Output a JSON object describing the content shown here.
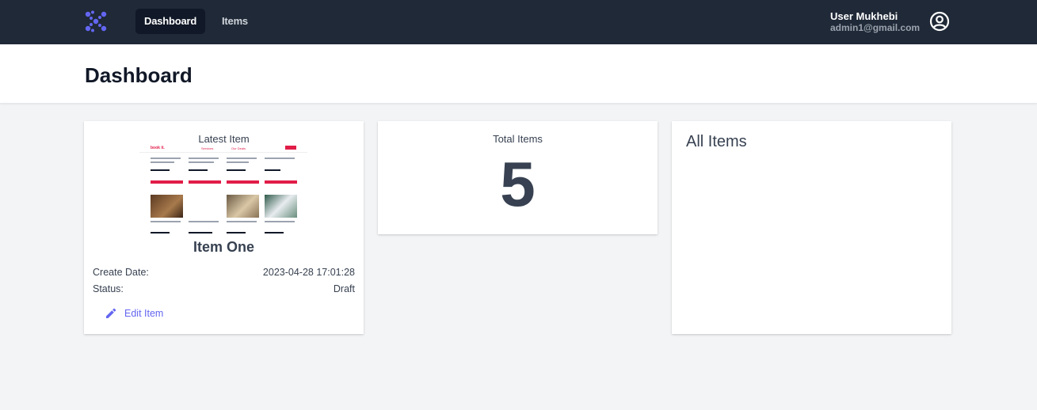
{
  "nav": {
    "links": [
      "Dashboard",
      "Items"
    ],
    "active": "Dashboard",
    "logo_icon": "logo-icon",
    "user_name": "User Mukhebi",
    "user_email": "admin1@gmail.com",
    "user_icon": "user-circle-icon"
  },
  "header": {
    "title": "Dashboard"
  },
  "latest_item": {
    "heading": "Latest Item",
    "name": "Item One",
    "create_date_label": "Create Date:",
    "create_date_value": "2023-04-28 17:01:28",
    "status_label": "Status:",
    "status_value": "Draft",
    "edit_label": "Edit Item",
    "edit_icon": "pencil-icon",
    "thumbnail": {
      "brand": "book it.",
      "tabs": [
        "Services",
        "Our Deals"
      ]
    }
  },
  "total_items": {
    "label": "Total Items",
    "value": "5"
  },
  "all_items": {
    "title": "All Items"
  },
  "colors": {
    "nav_bg": "#1f2937",
    "accent": "#6366f1",
    "thumb_accent": "#e11d48",
    "page_bg": "#f3f4f6"
  }
}
